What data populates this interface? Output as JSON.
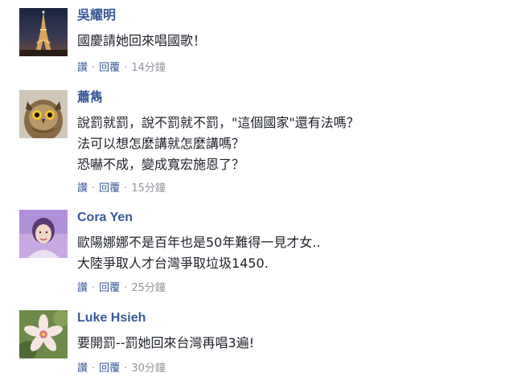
{
  "comments": [
    {
      "author": "吳耀明",
      "avatar": "eiffel-tower-photo",
      "lines": [
        "國慶請她回來唱國歌！"
      ],
      "like_label": "讚",
      "reply_label": "回覆",
      "separator": "·",
      "time": "14分鐘"
    },
    {
      "author": "蕭雋",
      "avatar": "owl-photo",
      "lines": [
        "說罰就罰，說不罰就不罰，\"這個國家\"還有法嗎？",
        "法可以想怎麼講就怎麼講嗎？",
        "恐嚇不成，變成寬宏施恩了？"
      ],
      "like_label": "讚",
      "reply_label": "回覆",
      "separator": "·",
      "time": "15分鐘"
    },
    {
      "author": "Cora Yen",
      "avatar": "woman-portrait-photo",
      "lines": [
        "歐陽娜娜不是百年也是50年難得一見才女..",
        "大陸爭取人才台灣爭取垃圾1450."
      ],
      "like_label": "讚",
      "reply_label": "回覆",
      "separator": "·",
      "time": "25分鐘"
    },
    {
      "author": "Luke Hsieh",
      "avatar": "flower-photo",
      "lines": [
        "要開罰--罰她回來台灣再唱3遍!"
      ],
      "like_label": "讚",
      "reply_label": "回覆",
      "separator": "·",
      "time": "30分鐘"
    }
  ],
  "colors": {
    "author": "#385898",
    "text": "#1d2129",
    "meta": "#90949c"
  }
}
